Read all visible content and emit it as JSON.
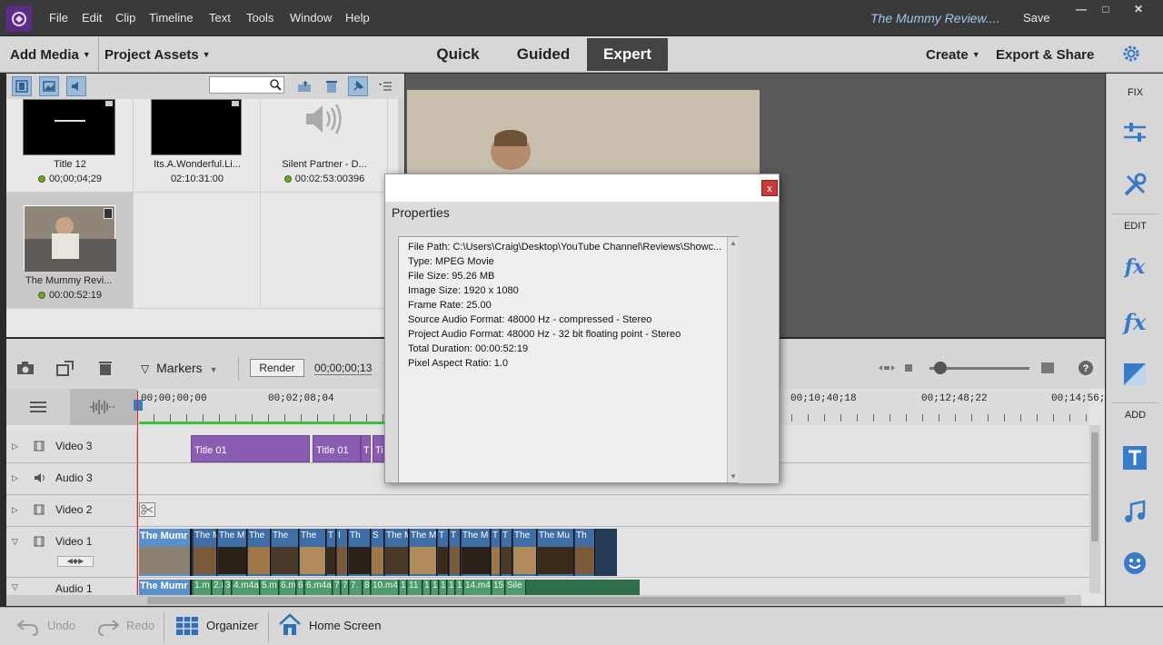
{
  "menubar": {
    "items": [
      "File",
      "Edit",
      "Clip",
      "Timeline",
      "Text",
      "Tools",
      "Window",
      "Help"
    ],
    "project_name": "The Mummy Review....",
    "save_label": "Save"
  },
  "modebar": {
    "add_media": "Add Media",
    "project_assets": "Project Assets",
    "tabs": [
      "Quick",
      "Guided",
      "Expert"
    ],
    "active_tab": "Expert",
    "create": "Create",
    "export_share": "Export & Share"
  },
  "assets": {
    "items": [
      {
        "name": "Title 12",
        "duration": "00;00;04;29",
        "kind": "title"
      },
      {
        "name": "Its.A.Wonderful.Li...",
        "duration": "02:10:31:00",
        "kind": "video"
      },
      {
        "name": "Silent Partner - D...",
        "duration": "00:02:53:00396",
        "kind": "audio"
      },
      {
        "name": "The Mummy Revi...",
        "duration": "00:00:52:19",
        "kind": "video",
        "selected": true
      }
    ]
  },
  "right_panel": {
    "fix": "FIX",
    "edit": "EDIT",
    "add": "ADD"
  },
  "timeline": {
    "markers": "Markers",
    "render": "Render",
    "timecode": "00;00;00;13",
    "ruler": [
      "00;00;00;00",
      "00;02;08;04",
      "00;10;40;18",
      "00;12;48;22",
      "00;14;56;"
    ],
    "tracks": [
      "Video 3",
      "Audio 3",
      "Video 2",
      "Video 1",
      "Audio 1"
    ],
    "clips": {
      "title01_a": "Title 01",
      "title01_b": "Title 01",
      "title_t": "T",
      "title_t2": "Ti",
      "v1_first": "The Mumr",
      "a1_first": "The Mumr",
      "v1_labels": [
        "The M",
        "The M",
        "The",
        "The",
        "The",
        "T",
        "I",
        "Th",
        "S",
        "The M",
        "The M",
        "T",
        "T",
        "The M",
        "T",
        "T",
        "The",
        "The Mu",
        "Th"
      ],
      "a1_labels": [
        "1.m",
        "2.r",
        "3",
        "4.m4a",
        "5.m",
        "6.m",
        "6",
        "6.m4a",
        "7",
        "7",
        "7.",
        "8",
        "10.m4",
        "1",
        "11",
        "1",
        "1",
        "1",
        "1",
        "1",
        "14.m4",
        "15",
        "Sile"
      ]
    }
  },
  "dialog": {
    "close": "x",
    "title": "Properties",
    "lines": [
      "File Path: C:\\Users\\Craig\\Desktop\\YouTube Channel\\Reviews\\Showc...",
      "Type: MPEG Movie",
      "File Size: 95.26 MB",
      "Image Size: 1920 x 1080",
      "Frame Rate: 25.00",
      "Source Audio Format: 48000 Hz - compressed - Stereo",
      "Project Audio Format: 48000 Hz - 32 bit floating point - Stereo",
      "Total Duration: 00:00:52:19",
      "Pixel Aspect Ratio: 1.0"
    ]
  },
  "bottombar": {
    "undo": "Undo",
    "redo": "Redo",
    "organizer": "Organizer",
    "home_screen": "Home Screen"
  },
  "colors": {
    "accent_blue": "#9ec7ee",
    "title_clip": "#8a5db3",
    "video_clip": "#5b8fc9",
    "audio_clip": "#4f9a6e",
    "playhead": "#dd2222"
  }
}
